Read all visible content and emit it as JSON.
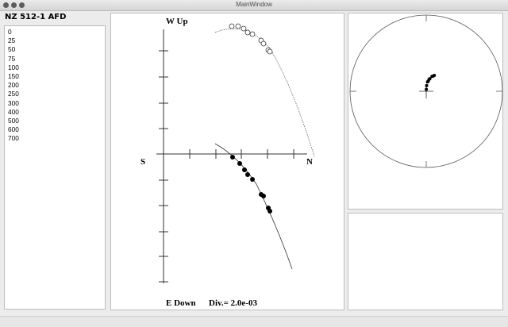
{
  "window": {
    "title": "MainWindow"
  },
  "sample": {
    "title": "NZ 512-1 AFD"
  },
  "steps": [
    "0",
    "25",
    "50",
    "75",
    "100",
    "150",
    "200",
    "250",
    "300",
    "400",
    "500",
    "600",
    "700"
  ],
  "zplot": {
    "label_up": "W Up",
    "label_down": "E Down",
    "label_left": "S",
    "label_right": "N",
    "division": "Div.= 2.0e-03"
  },
  "equal_area": {
    "points": [
      {
        "az": 2,
        "inc": 88
      },
      {
        "az": 4,
        "inc": 84
      },
      {
        "az": 8,
        "inc": 80
      },
      {
        "az": 11,
        "inc": 79
      },
      {
        "az": 13,
        "inc": 77
      },
      {
        "az": 16,
        "inc": 76
      },
      {
        "az": 21,
        "inc": 73
      },
      {
        "az": 25,
        "inc": 72
      },
      {
        "az": 27,
        "inc": 71
      }
    ]
  },
  "colors": {
    "line": "#333333",
    "marker": "#000000"
  }
}
